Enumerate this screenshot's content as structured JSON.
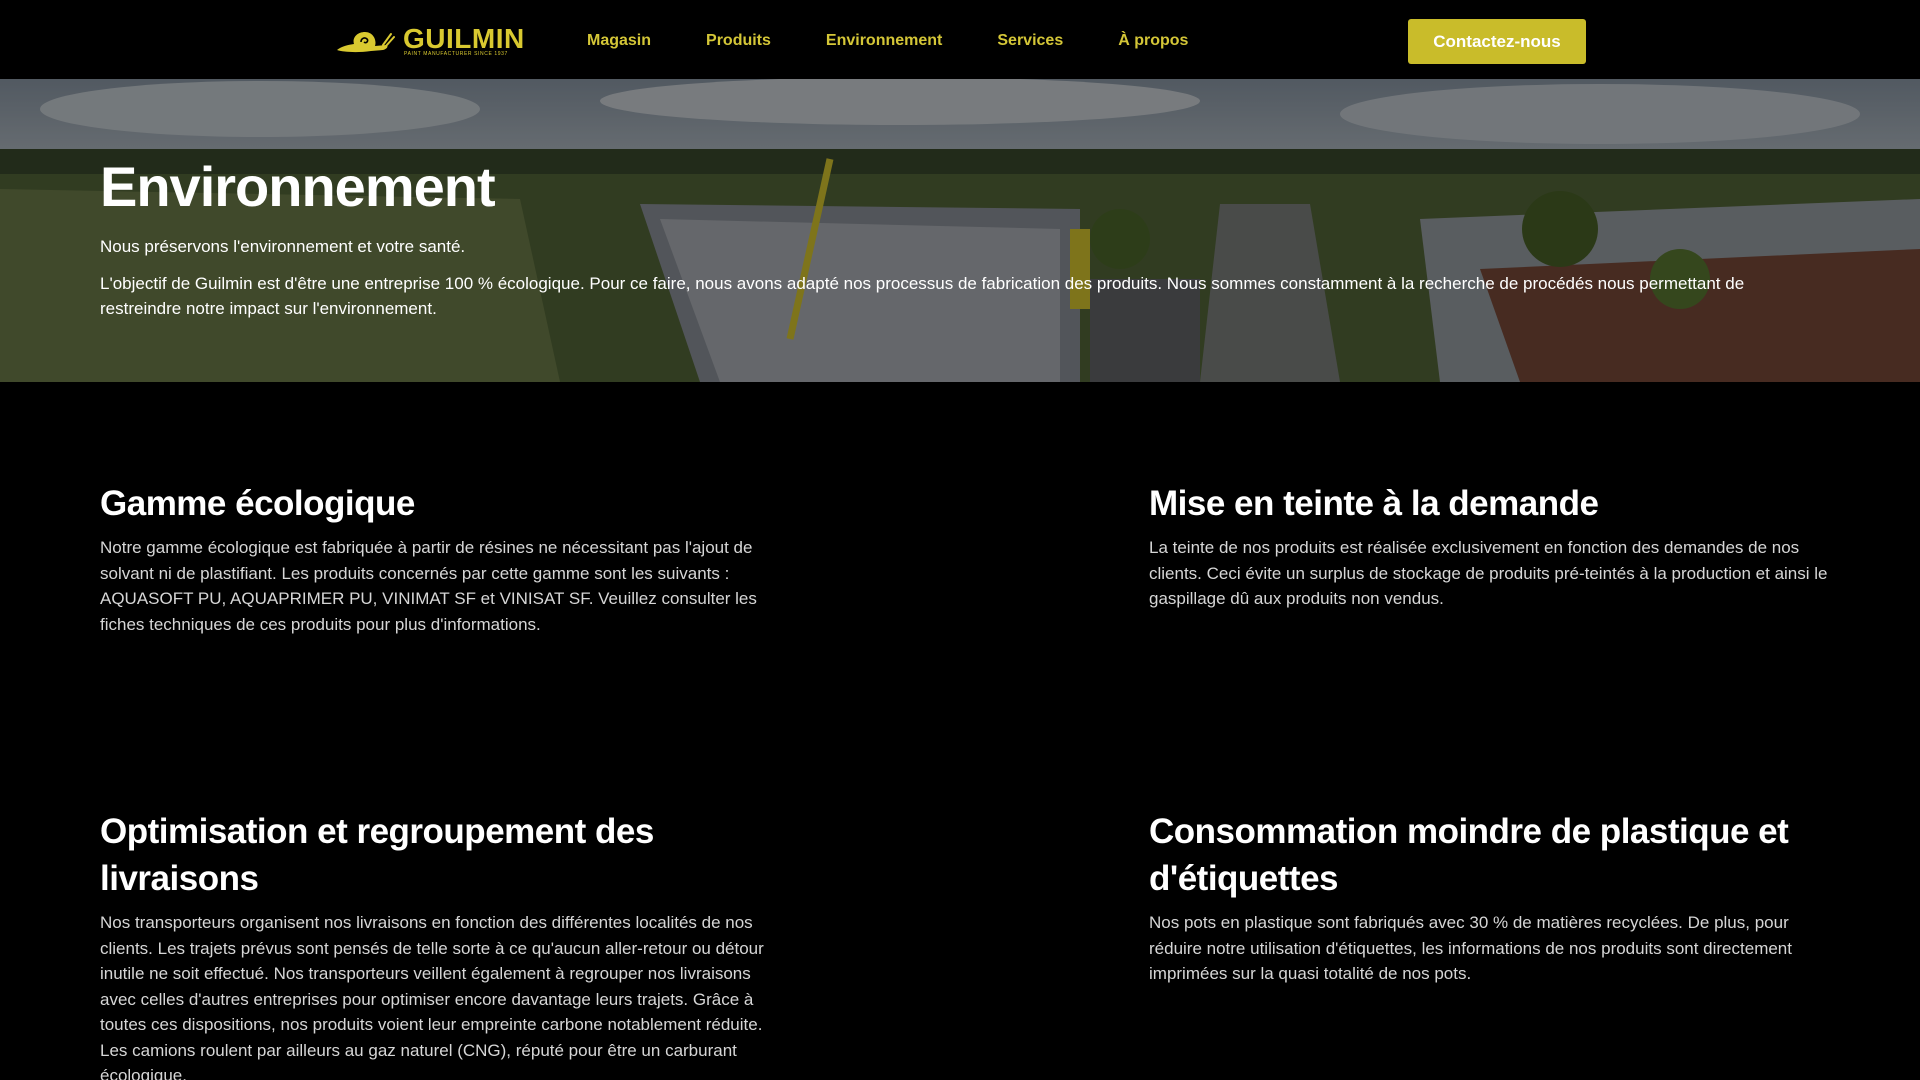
{
  "brand": {
    "name": "GUILMIN",
    "tagline": "PAINT MANUFACTURER SINCE 1937",
    "color": "#d9c930"
  },
  "nav": {
    "items": [
      "Magasin",
      "Produits",
      "Environnement",
      "Services",
      "À propos"
    ]
  },
  "header": {
    "cta_label": "Contactez-nous",
    "cta_color": "#c9bc2a"
  },
  "hero": {
    "title": "Environnement",
    "subtitle": "Nous préservons l'environnement et votre santé.",
    "description": "L'objectif de Guilmin est d'être une entreprise 100 % écologique. Pour ce faire, nous avons adapté nos processus de fabrication des produits. Nous sommes constamment à la recherche de procédés nous permettant de restreindre notre impact sur l'environnement."
  },
  "sections": [
    {
      "title": "Gamme écologique",
      "text": "Notre gamme écologique est fabriquée à partir de résines ne nécessitant pas l'ajout de solvant ni de plastifiant. Les produits concernés par cette gamme sont les suivants : AQUASOFT PU, AQUAPRIMER PU, VINIMAT SF et VINISAT SF. Veuillez consulter les fiches techniques de ces produits pour plus d'informations."
    },
    {
      "title": "Mise en teinte à la demande",
      "text": "La teinte de nos produits est réalisée exclusivement en fonction des demandes de nos clients. Ceci évite un surplus de stockage de produits pré-teintés à la production et ainsi le gaspillage dû aux produits non vendus."
    },
    {
      "title": "Optimisation et regroupement des livraisons",
      "text": "Nos transporteurs organisent nos livraisons en fonction des différentes localités de nos clients. Les trajets prévus sont pensés de telle sorte à ce qu'aucun aller-retour ou détour inutile ne soit effectué. Nos transporteurs veillent également à regrouper nos livraisons avec celles d'autres entreprises pour optimiser encore davantage leurs trajets. Grâce à toutes ces dispositions, nos produits voient leur empreinte carbone notablement réduite. Les camions roulent par ailleurs au gaz naturel (CNG), réputé pour être un carburant écologique."
    },
    {
      "title": "Consommation moindre de plastique et d'étiquettes",
      "text": "Nos pots en plastique sont fabriqués avec 30 % de matières recyclées. De plus, pour réduire notre utilisation d'étiquettes, les informations de nos produits sont directement imprimées sur la quasi totalité de nos pots."
    }
  ]
}
